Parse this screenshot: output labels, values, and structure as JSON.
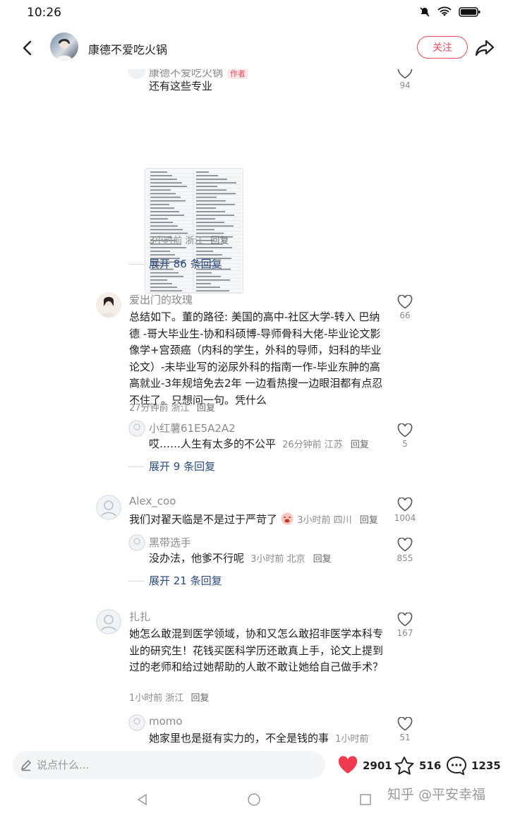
{
  "status_bar": {
    "time": "10:26"
  },
  "header": {
    "author_name": "康德不爱吃火锅",
    "follow_label": "关注"
  },
  "comments": [
    {
      "name": "康德不爱吃火锅",
      "tag": "作者",
      "text": "还有这些专业",
      "meta": "3小时前 浙江",
      "reply": "回复",
      "likes": "94",
      "expand": "展开 86 条回复"
    },
    {
      "name": "爱出门的玫瑰",
      "text": "总结如下。董的路径: 美国的高中-社区大学-转入 巴纳德 -哥大毕业生-协和科硕博-导师骨科大佬-毕业论文影像学+宫颈癌（内科的学生，外科的导师，妇科的毕业论文）-未毕业写的泌尿外科的指南一作-毕业东肿的高高就业-3年规培免去2年 一边看热搜一边眼泪都有点忍不住了。只想问一句。凭什么",
      "meta": "27分钟前 浙江",
      "reply": "回复",
      "likes": "66",
      "sub": {
        "name": "小红薯61E5A2A2",
        "text": "哎……人生有太多的不公平",
        "meta": "26分钟前 江苏",
        "reply": "回复",
        "likes": "5"
      },
      "expand": "展开 9 条回复"
    },
    {
      "name": "Alex_coo",
      "text": "我们对翟天临是不是过于严苛了",
      "meta": "3小时前 四川",
      "reply": "回复",
      "likes": "1004",
      "sub": {
        "name": "黑带选手",
        "text": "没办法，他爹不行呢",
        "meta": "3小时前 北京",
        "reply": "回复",
        "likes": "855"
      },
      "expand": "展开 21 条回复"
    },
    {
      "name": "扎扎",
      "text": "她怎么敢混到医学领域，协和又怎么敢招非医学本科专业的研究生！花钱买医科学历还敢真上手，论文上提到过的老师和给过她帮助的人敢不敢让她给自己做手术？",
      "meta": "1小时前 浙江",
      "reply": "回复",
      "likes": "167",
      "sub": {
        "name": "momo",
        "text": "她家里也是挺有实力的，不全是钱的事",
        "meta": "1小时前",
        "likes": "51"
      }
    }
  ],
  "bottom_bar": {
    "input_placeholder": "说点什么...",
    "likes": "2901",
    "stars": "516",
    "comments": "1235"
  },
  "watermark": "知乎 @平安幸福",
  "colors": {
    "accent": "#f04a5c",
    "link": "#2b4a84",
    "muted": "#8c8c8c"
  },
  "icons": [
    "back-icon",
    "share-icon",
    "heart-icon",
    "star-icon",
    "comment-icon",
    "edit-icon",
    "dnd-icon",
    "wifi-icon",
    "battery-icon"
  ]
}
